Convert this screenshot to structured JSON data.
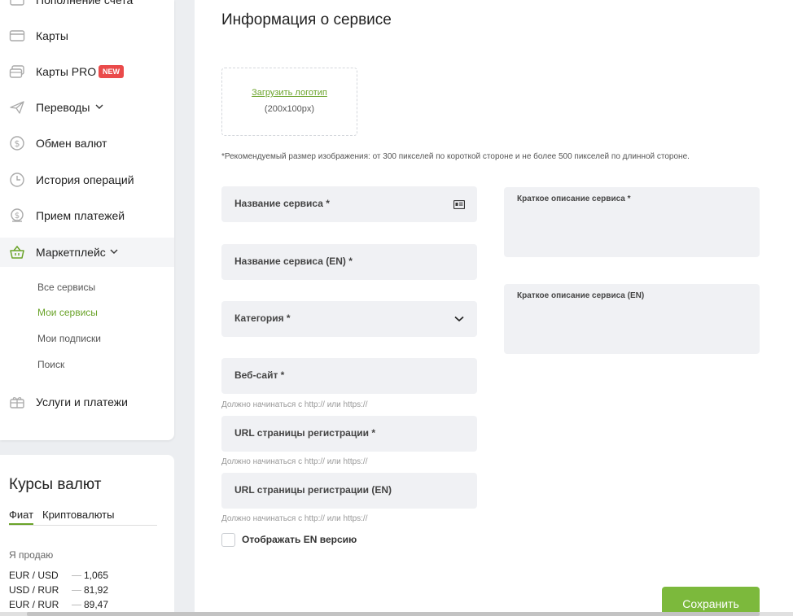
{
  "sidebar": {
    "items": [
      {
        "label": "Пополнение счета",
        "icon": "wallet-icon"
      },
      {
        "label": "Карты",
        "icon": "card-icon"
      },
      {
        "label": "Карты PRO",
        "icon": "card-pro-icon",
        "badge": "NEW"
      },
      {
        "label": "Переводы",
        "icon": "paper-plane-icon"
      },
      {
        "label": "Обмен валют",
        "icon": "dollar-icon"
      },
      {
        "label": "История операций",
        "icon": "clock-icon"
      },
      {
        "label": "Прием платежей",
        "icon": "coins-icon"
      },
      {
        "label": "Маркетплейс",
        "icon": "basket-icon"
      },
      {
        "label": "Услуги и платежи",
        "icon": "gift-icon"
      }
    ],
    "submenu": [
      {
        "label": "Все сервисы"
      },
      {
        "label": "Мои сервисы"
      },
      {
        "label": "Мои подписки"
      },
      {
        "label": "Поиск"
      }
    ]
  },
  "rates": {
    "title": "Курсы валют",
    "tabs": [
      "Фиат",
      "Криптовалюты"
    ],
    "sell_label": "Я продаю",
    "rows": [
      {
        "pair": "EUR / USD",
        "value": "1,065"
      },
      {
        "pair": "USD / RUR",
        "value": "81,92"
      },
      {
        "pair": "EUR / RUR",
        "value": "89,47"
      }
    ]
  },
  "form": {
    "title": "Информация о сервисе",
    "logo_link": "Загрузить логотип",
    "logo_size": "(200x100px)",
    "image_hint": "*Рекомендуемый размер изображения: от 300 пикселей по короткой стороне и не более 500 пикселей по длинной стороне.",
    "name": "Название сервиса *",
    "name_en": "Название сервиса (EN) *",
    "category": "Категория *",
    "website": "Веб-сайт *",
    "reg_url": "URL страницы регистрации *",
    "reg_url_en": "URL страницы регистрации (EN)",
    "url_hint": "Должно начинаться с http:// или https://",
    "short_desc": "Краткое описание сервиса *",
    "short_desc_en": "Краткое описание сервиса (EN)",
    "show_en": "Отображать EN версию",
    "save": "Сохранить"
  },
  "colors": {
    "accent": "#7cb93c",
    "badge": "#ea4a4a"
  }
}
